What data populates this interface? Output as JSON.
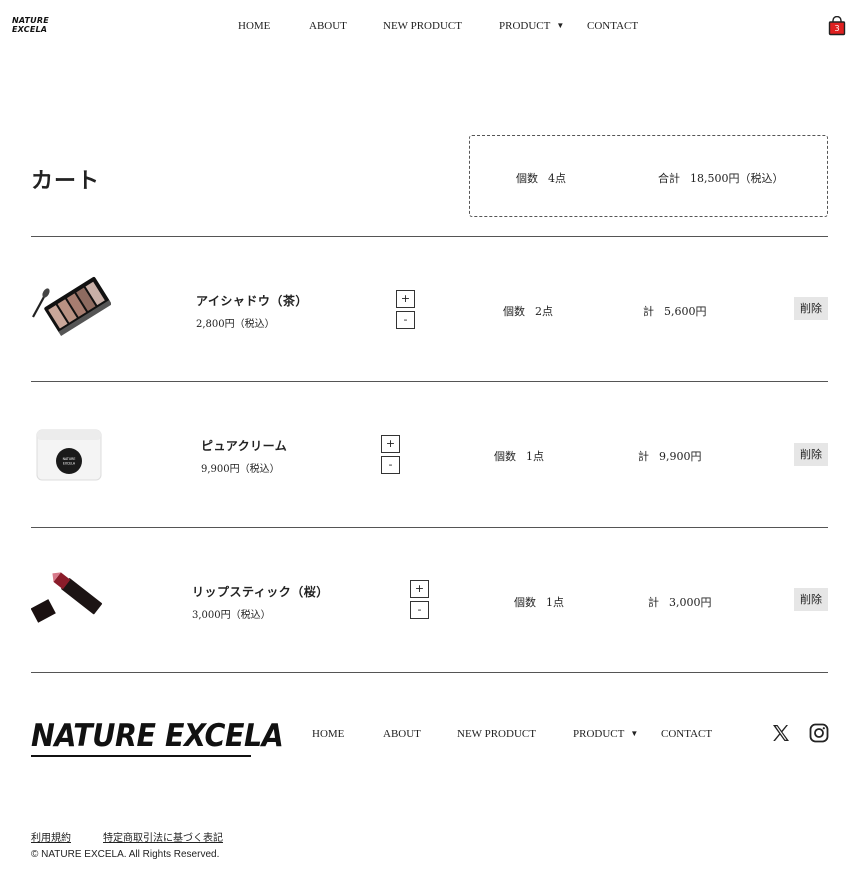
{
  "header": {
    "logo_line1": "NATURE",
    "logo_line2": "EXCELA",
    "nav": [
      "HOME",
      "ABOUT",
      "NEW PRODUCT",
      "PRODUCT",
      "CONTACT"
    ],
    "cart_count": "3",
    "caret": "▼"
  },
  "cart": {
    "title": "カート",
    "summary_count_label": "個数",
    "summary_count_value": "4点",
    "summary_total_label": "合計",
    "summary_total_value": "18,500円（税込）"
  },
  "items": [
    {
      "name": "アイシャドウ（茶）",
      "price": "2,800円（税込）",
      "plus": "+",
      "minus": "-",
      "count_label": "個数",
      "count_value": "2点",
      "subtotal_label": "計",
      "subtotal_value": "5,600円",
      "delete_label": "削除"
    },
    {
      "name": "ピュアクリーム",
      "price": "9,900円（税込）",
      "plus": "+",
      "minus": "-",
      "count_label": "個数",
      "count_value": "1点",
      "subtotal_label": "計",
      "subtotal_value": "9,900円",
      "delete_label": "削除",
      "jar_label_line1": "NATURE",
      "jar_label_line2": "EXCELA"
    },
    {
      "name": "リップスティック（桜）",
      "price": "3,000円（税込）",
      "plus": "+",
      "minus": "-",
      "count_label": "個数",
      "count_value": "1点",
      "subtotal_label": "計",
      "subtotal_value": "3,000円",
      "delete_label": "削除"
    }
  ],
  "footer": {
    "logo": "NATURE EXCELA",
    "nav": [
      "HOME",
      "ABOUT",
      "NEW PRODUCT",
      "PRODUCT",
      "CONTACT"
    ],
    "caret": "▼",
    "legal_terms": "利用規約",
    "legal_commerce": "特定商取引法に基づく表記",
    "copyright": "© NATURE EXCELA. All Rights Reserved."
  },
  "colors": {
    "cart_badge": "#e02020",
    "delete_bg": "#e6e6e6",
    "divider": "#555555"
  },
  "icons": {
    "cart": "shopping-bag-icon",
    "x": "x-logo-icon",
    "instagram": "instagram-icon"
  }
}
